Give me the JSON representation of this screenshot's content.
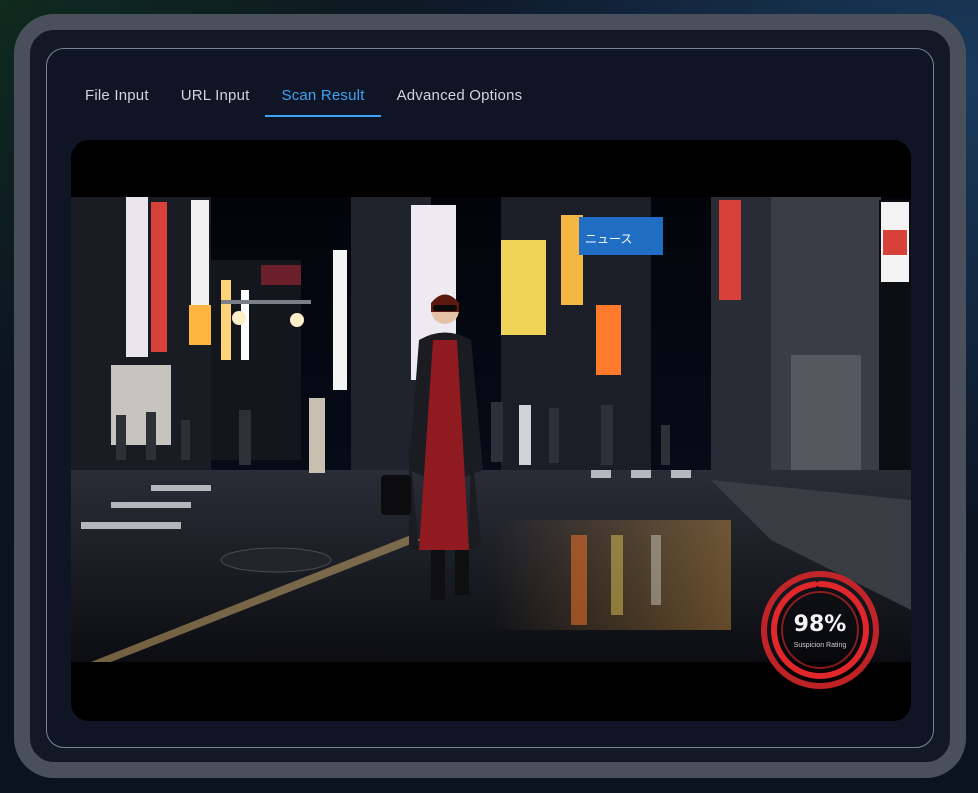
{
  "tabs": [
    {
      "label": "File Input",
      "active": false
    },
    {
      "label": "URL Input",
      "active": false
    },
    {
      "label": "Scan Result",
      "active": true
    },
    {
      "label": "Advanced Options",
      "active": false
    }
  ],
  "scan_result": {
    "percentage": "98%",
    "rating": 0.98,
    "label": "Suspicion Rating",
    "gauge_color": "#e0282c"
  },
  "colors": {
    "accent": "#3fa3f5",
    "frame": "#4a4f5c",
    "panel_border": "#7c8394"
  },
  "media": {
    "street_sign_text": "ニュース"
  }
}
